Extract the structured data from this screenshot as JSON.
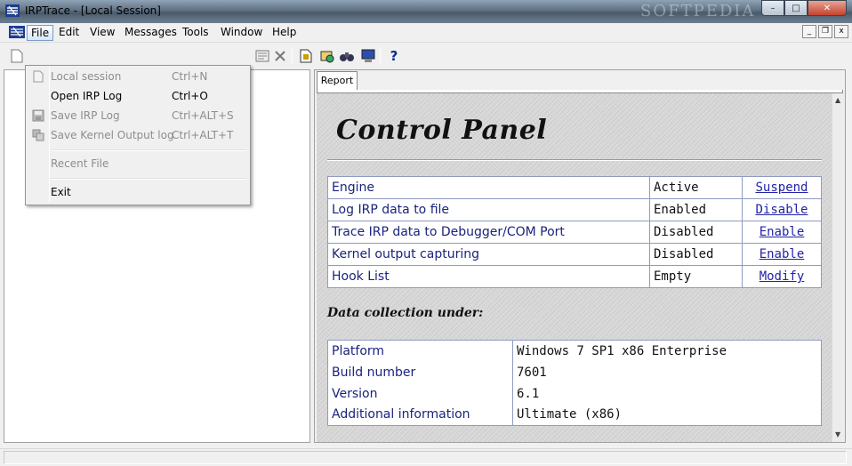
{
  "window": {
    "title": "IRPTrace - [Local Session]",
    "watermark": "SOFTPEDIA",
    "caption_minimize": "–",
    "caption_maximize": "□",
    "caption_close": "✕"
  },
  "menubar": {
    "items": [
      "File",
      "Edit",
      "View",
      "Messages",
      "Tools",
      "Window",
      "Help"
    ],
    "active": "File",
    "mdi_minimize": "_",
    "mdi_restore": "❐",
    "mdi_close": "x"
  },
  "file_menu": {
    "items": [
      {
        "label": "Local session",
        "shortcut": "Ctrl+N",
        "enabled": false,
        "icon": "new-document-icon"
      },
      {
        "label": "Open IRP Log",
        "shortcut": "Ctrl+O",
        "enabled": true,
        "icon": ""
      },
      {
        "label": "Save IRP Log",
        "shortcut": "Ctrl+ALT+S",
        "enabled": false,
        "icon": "save-icon"
      },
      {
        "label": "Save Kernel Output log",
        "shortcut": "Ctrl+ALT+T",
        "enabled": false,
        "icon": "save-kernel-log-icon"
      },
      {
        "label": "Recent File",
        "shortcut": "",
        "enabled": false,
        "icon": ""
      },
      {
        "label": "Exit",
        "shortcut": "",
        "enabled": true,
        "icon": ""
      }
    ]
  },
  "toolbar": {
    "help_glyph": "?"
  },
  "report": {
    "tab_label": "Report",
    "heading": "Control Panel",
    "controls": [
      {
        "name": "Engine",
        "state": "Active",
        "action": "Suspend"
      },
      {
        "name": "Log IRP data to file",
        "state": "Enabled",
        "action": "Disable"
      },
      {
        "name": "Trace IRP data to Debugger/COM Port",
        "state": "Disabled",
        "action": "Enable"
      },
      {
        "name": "Kernel output capturing",
        "state": "Disabled",
        "action": "Enable"
      },
      {
        "name": "Hook List",
        "state": "Empty",
        "action": "Modify"
      }
    ],
    "collection_heading": "Data collection under:",
    "system_info": [
      {
        "key": "Platform",
        "value": "Windows 7 SP1 x86 Enterprise"
      },
      {
        "key": "Build number",
        "value": "7601"
      },
      {
        "key": "Version",
        "value": "6.1"
      },
      {
        "key": "Additional information",
        "value": "Ultimate (x86)"
      }
    ]
  },
  "colors": {
    "label_blue": "#1a237e",
    "link_blue": "#2222aa",
    "table_border": "#8f9bc3"
  }
}
